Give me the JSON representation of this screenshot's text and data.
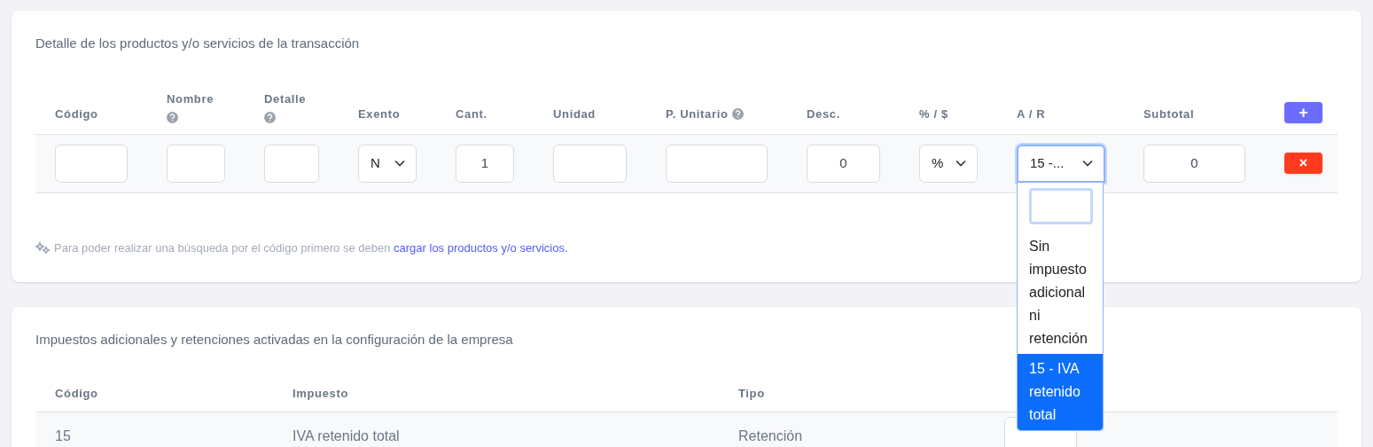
{
  "products_card": {
    "title": "Detalle de los productos y/o servicios de la transacción",
    "columns": [
      {
        "label": "Código"
      },
      {
        "label": "Nombre",
        "help": true
      },
      {
        "label": "Detalle",
        "help": true
      },
      {
        "label": "Exento"
      },
      {
        "label": "Cant."
      },
      {
        "label": "Unidad"
      },
      {
        "label": "P. Unitario",
        "help": true
      },
      {
        "label": "Desc."
      },
      {
        "label": "% / $"
      },
      {
        "label": "A / R"
      },
      {
        "label": "Subtotal"
      }
    ],
    "add_button": {
      "label": "+"
    },
    "row": {
      "cells": [
        {
          "kind": "input"
        },
        {
          "kind": "input"
        },
        {
          "kind": "input"
        },
        {
          "kind": "select",
          "value": "N"
        },
        {
          "kind": "input",
          "value": "1"
        },
        {
          "kind": "input"
        },
        {
          "kind": "input"
        },
        {
          "kind": "input",
          "value": "0"
        },
        {
          "kind": "select",
          "value": "%"
        },
        {
          "kind": "select",
          "value": "15 -...",
          "open": true
        },
        {
          "kind": "input",
          "value": "0"
        }
      ],
      "remove_button": {
        "label": "×"
      }
    },
    "dropdown": {
      "options": [
        {
          "label": "Sin impuesto adicional ni retención",
          "selected": false
        },
        {
          "label": "15 - IVA retenido total",
          "selected": true
        }
      ]
    },
    "note": {
      "text": "Para poder realizar una búsqueda por el código primero se deben",
      "link": "cargar los productos y/o servicios."
    }
  },
  "taxes_card": {
    "title": "Impuestos adicionales y retenciones activadas en la configuración de la empresa",
    "columns": [
      "Código",
      "Impuesto",
      "Tipo"
    ],
    "rows": [
      {
        "cells": [
          "15",
          "IVA retenido total",
          "Retención"
        ]
      }
    ]
  }
}
